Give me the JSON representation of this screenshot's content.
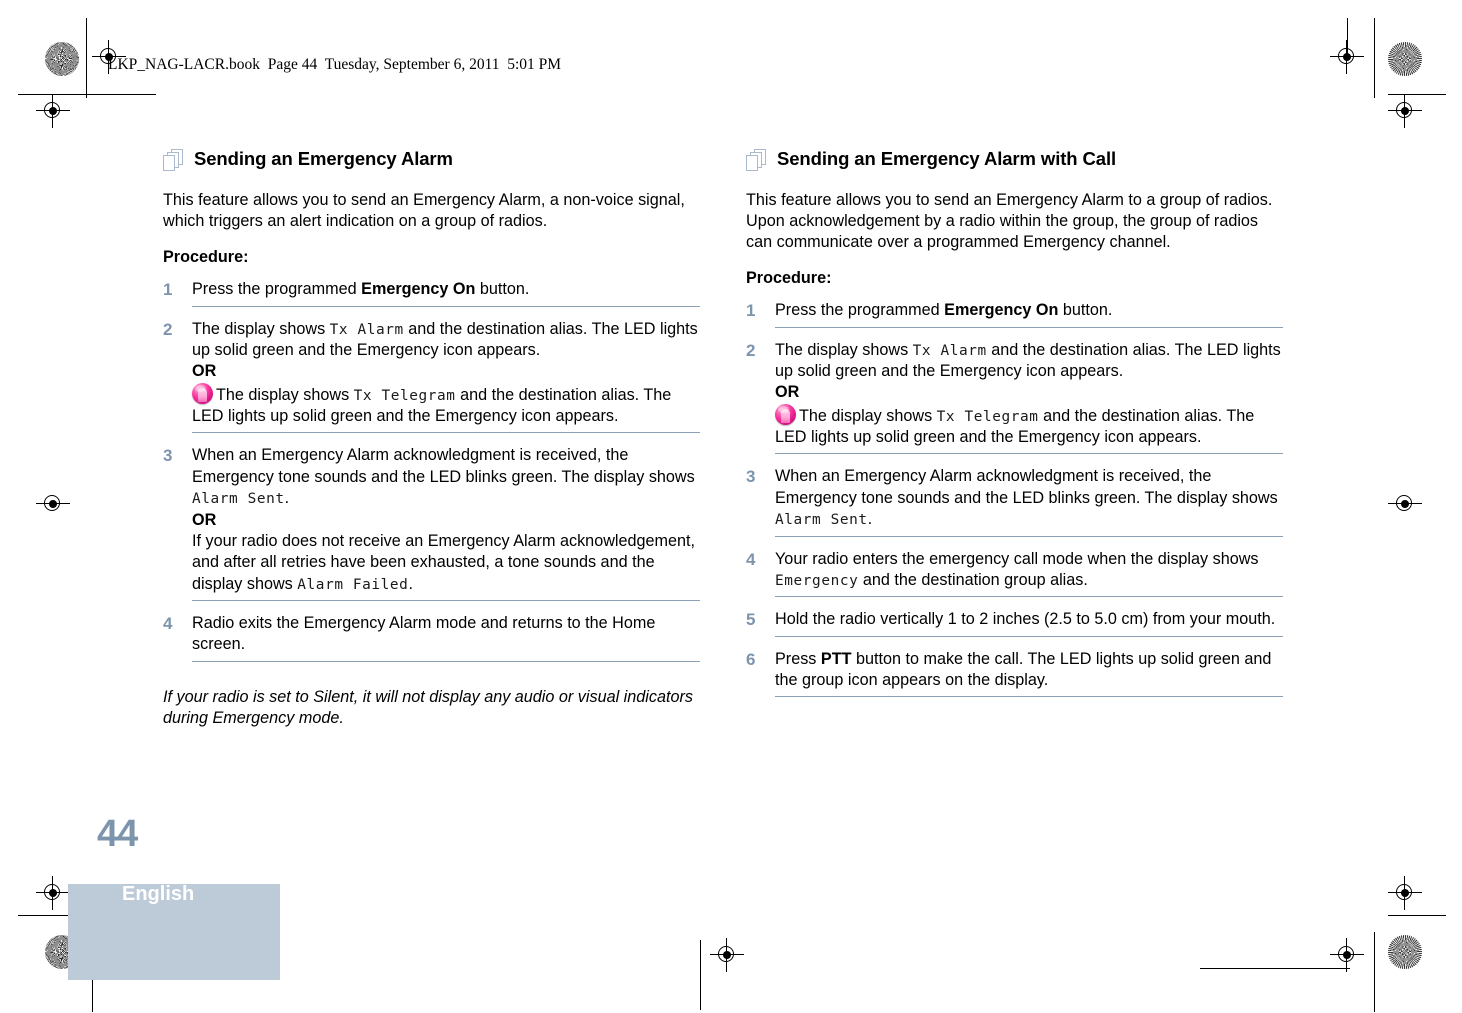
{
  "running_header": "LKP_NAG-LACR.book  Page 44  Tuesday, September 6, 2011  5:01 PM",
  "footer": {
    "page_number": "44",
    "language": "English"
  },
  "colors": {
    "accent_blue": "#7d94ad",
    "rule_blue": "#8ba0b5",
    "footer_band": "#bdcbd9",
    "icon_outline": "#aab9cb",
    "telegram_pink": "#f7319b"
  },
  "columns": [
    {
      "heading_icon": "stacked-pages-icon",
      "heading": "Sending an Emergency Alarm",
      "intro": "This feature allows you to send an Emergency Alarm, a non-voice signal, which triggers an alert indication on a group of radios.",
      "procedure_label": "Procedure:",
      "steps": [
        {
          "num": "1",
          "segments": [
            {
              "type": "text",
              "value": "Press the programmed "
            },
            {
              "type": "bold",
              "value": "Emergency On"
            },
            {
              "type": "text",
              "value": " button."
            }
          ]
        },
        {
          "num": "2",
          "segments": [
            {
              "type": "text",
              "value": "The display shows "
            },
            {
              "type": "lcd",
              "value": "Tx Alarm"
            },
            {
              "type": "text",
              "value": " and the destination alias. The LED lights up solid green and the Emergency icon appears."
            },
            {
              "type": "break"
            },
            {
              "type": "bold",
              "value": "OR"
            },
            {
              "type": "break"
            },
            {
              "type": "icon",
              "value": "telegram-icon"
            },
            {
              "type": "text",
              "value": "The display shows "
            },
            {
              "type": "lcd",
              "value": "Tx Telegram"
            },
            {
              "type": "text",
              "value": " and the destination alias. The LED lights up solid green and the Emergency icon appears."
            }
          ]
        },
        {
          "num": "3",
          "segments": [
            {
              "type": "text",
              "value": "When an Emergency Alarm acknowledgment is received, the Emergency tone sounds and the LED blinks green. The display shows "
            },
            {
              "type": "lcd",
              "value": "Alarm Sent"
            },
            {
              "type": "text",
              "value": "."
            },
            {
              "type": "break"
            },
            {
              "type": "bold",
              "value": "OR"
            },
            {
              "type": "break"
            },
            {
              "type": "text",
              "value": "If your radio does not receive an Emergency Alarm acknowledgement, and after all retries have been exhausted, a tone sounds and the display shows "
            },
            {
              "type": "lcd",
              "value": "Alarm Failed"
            },
            {
              "type": "text",
              "value": "."
            }
          ]
        },
        {
          "num": "4",
          "segments": [
            {
              "type": "text",
              "value": "Radio exits the Emergency Alarm mode and returns to the Home screen."
            }
          ]
        }
      ],
      "note": "If your radio is set to Silent, it will not display any audio or visual indicators during Emergency mode."
    },
    {
      "heading_icon": "stacked-pages-icon",
      "heading": "Sending an Emergency Alarm with Call",
      "intro": "This feature allows you to send an Emergency Alarm to a group of radios. Upon acknowledgement by a radio within the group, the group of radios can communicate over a programmed Emergency channel.",
      "procedure_label": "Procedure:",
      "steps": [
        {
          "num": "1",
          "segments": [
            {
              "type": "text",
              "value": "Press the programmed "
            },
            {
              "type": "bold",
              "value": "Emergency On"
            },
            {
              "type": "text",
              "value": " button."
            }
          ]
        },
        {
          "num": "2",
          "segments": [
            {
              "type": "text",
              "value": "The display shows "
            },
            {
              "type": "lcd",
              "value": "Tx Alarm"
            },
            {
              "type": "text",
              "value": " and the destination alias. The LED lights up solid green and the Emergency icon appears."
            },
            {
              "type": "break"
            },
            {
              "type": "bold",
              "value": "OR"
            },
            {
              "type": "break"
            },
            {
              "type": "icon",
              "value": "telegram-icon"
            },
            {
              "type": "text",
              "value": "The display shows "
            },
            {
              "type": "lcd",
              "value": "Tx Telegram"
            },
            {
              "type": "text",
              "value": " and the destination alias. The LED lights up solid green and the Emergency icon appears."
            }
          ]
        },
        {
          "num": "3",
          "segments": [
            {
              "type": "text",
              "value": "When an Emergency Alarm acknowledgment is received, the Emergency tone sounds and the LED blinks green. The display shows "
            },
            {
              "type": "lcd",
              "value": "Alarm Sent"
            },
            {
              "type": "text",
              "value": "."
            }
          ]
        },
        {
          "num": "4",
          "segments": [
            {
              "type": "text",
              "value": "Your radio enters the emergency call mode when the display shows "
            },
            {
              "type": "lcd",
              "value": "Emergency"
            },
            {
              "type": "text",
              "value": " and the destination group alias."
            }
          ]
        },
        {
          "num": "5",
          "segments": [
            {
              "type": "text",
              "value": "Hold the radio vertically 1 to 2 inches (2.5 to 5.0 cm) from your mouth."
            }
          ]
        },
        {
          "num": "6",
          "segments": [
            {
              "type": "text",
              "value": "Press "
            },
            {
              "type": "bold",
              "value": "PTT"
            },
            {
              "type": "text",
              "value": " button to make the call. The LED lights up solid green and the group icon appears on the display."
            }
          ]
        }
      ],
      "note": ""
    }
  ]
}
